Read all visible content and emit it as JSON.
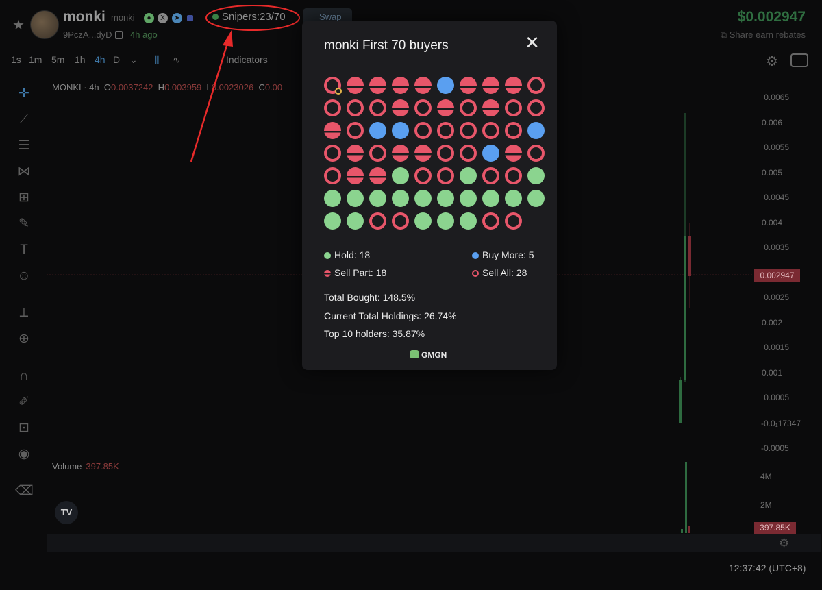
{
  "header": {
    "token_name": "monki",
    "token_symbol": "monki",
    "address_short": "9PczA...dyD",
    "age": "4h ago",
    "snipers_label": "Snipers:23/70",
    "swap_label": "Swap",
    "price": "$0.002947",
    "share_label": "Share earn rebates"
  },
  "toolbar": {
    "timeframes": [
      "1s",
      "1m",
      "5m",
      "1h",
      "4h",
      "D"
    ],
    "selected_timeframe": "4h",
    "indicators_label": "Indicators"
  },
  "chart": {
    "symbol_line": "MONKI · 4h",
    "open_label": "O",
    "open": "0.0037242",
    "high_label": "H",
    "high": "0.003959",
    "low_label": "L",
    "low": "0.0023026",
    "close_label": "C",
    "close": "0.00",
    "y_ticks": [
      "0.0065",
      "0.006",
      "0.0055",
      "0.005",
      "0.0045",
      "0.004",
      "0.0035",
      "0.0025",
      "0.002",
      "0.0015",
      "0.001",
      "0.0005"
    ],
    "zero_tick": "-0.0₁17347",
    "neg_tick": "-0.0005",
    "price_badge": "0.002947",
    "volume_label": "Volume",
    "volume_value": "397.85K",
    "vol_ticks": [
      "4M",
      "2M"
    ],
    "volume_badge": "397.85K",
    "time": "12:37:42 (UTC+8)",
    "tv_logo": "TV"
  },
  "modal": {
    "title": "monki First 70 buyers",
    "buyers": [
      "all",
      "part",
      "part",
      "part",
      "part",
      "more",
      "part",
      "part",
      "part",
      "all",
      "all",
      "all",
      "all",
      "part",
      "all",
      "part",
      "all",
      "part",
      "all",
      "all",
      "part",
      "all",
      "more",
      "more",
      "all",
      "all",
      "all",
      "all",
      "all",
      "more",
      "all",
      "part",
      "all",
      "part",
      "part",
      "all",
      "all",
      "more",
      "part",
      "all",
      "all",
      "part",
      "part",
      "hold",
      "all",
      "all",
      "hold",
      "all",
      "all",
      "hold",
      "hold",
      "hold",
      "hold",
      "hold",
      "hold",
      "hold",
      "hold",
      "hold",
      "hold",
      "hold",
      "hold",
      "hold",
      "all",
      "all",
      "hold",
      "hold",
      "hold",
      "all",
      "all"
    ],
    "legend": {
      "hold": "Hold: 18",
      "buy_more": "Buy More: 5",
      "sell_part": "Sell Part: 18",
      "sell_all": "Sell All: 28"
    },
    "stats": {
      "total_bought": "Total Bought: 148.5%",
      "current_holdings": "Current Total Holdings: 26.74%",
      "top10": "Top 10 holders: 35.87%"
    },
    "brand": "GMGN"
  },
  "colors": {
    "hold": "#8bd48f",
    "buy_more": "#5a9ff0",
    "sell": "#e8566a",
    "annotation": "#e82a2a",
    "modal_bg": "#1c1c1f"
  },
  "icons": [
    "star-icon",
    "pill-icon",
    "x-icon",
    "telegram-icon",
    "copy-icon",
    "share-icon",
    "gear-icon",
    "camera-icon",
    "close-icon",
    "crosshair-icon",
    "line-icon",
    "fib-icon",
    "pattern-icon",
    "ruler-icon",
    "brush-icon",
    "text-icon",
    "emoji-icon",
    "measure-icon",
    "zoom-icon",
    "magnet-icon",
    "lock-icon",
    "eye-icon",
    "trash-icon"
  ]
}
